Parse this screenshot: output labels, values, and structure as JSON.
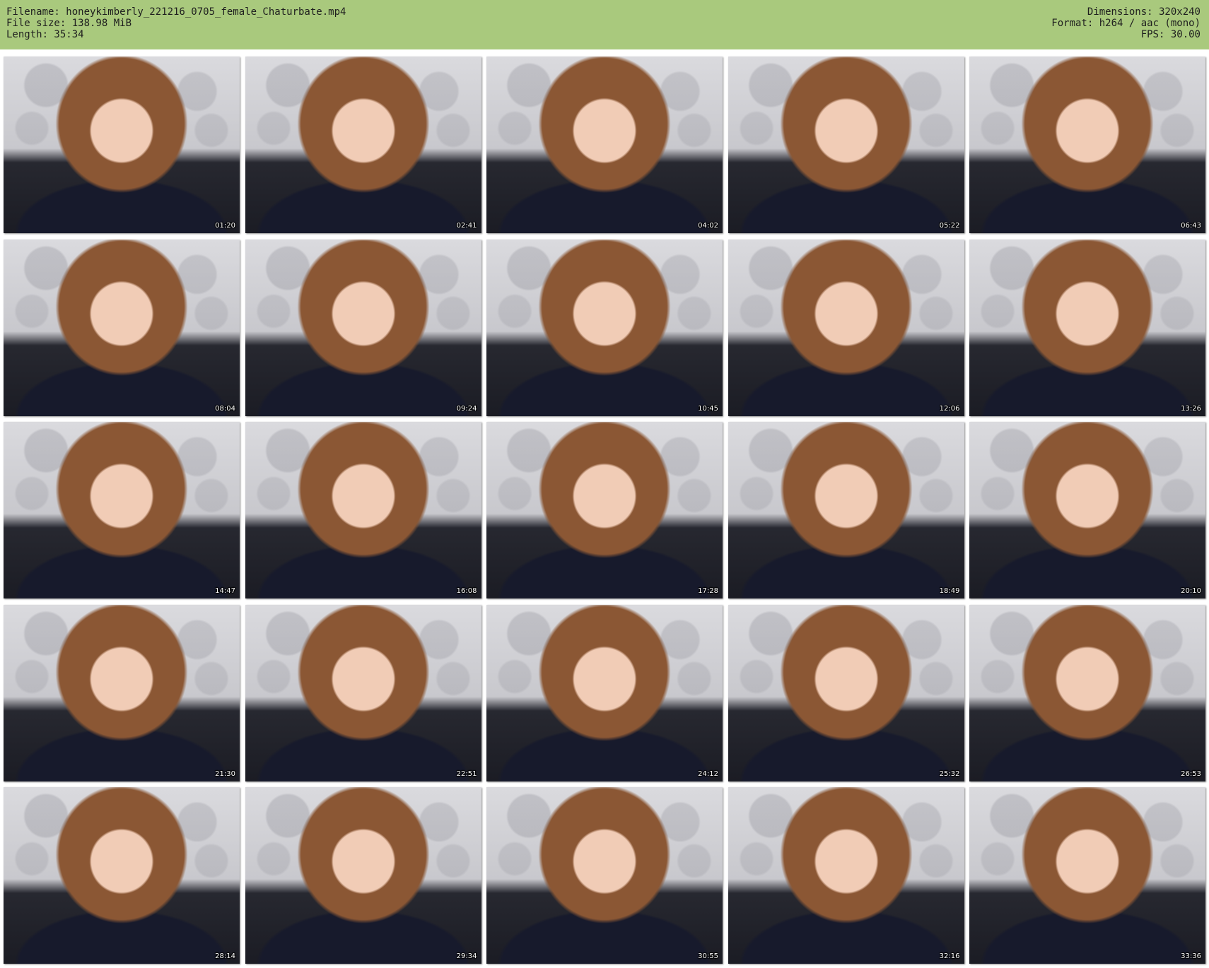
{
  "header": {
    "filename": "Filename: honeykimberly_221216_0705_female_Chaturbate.mp4",
    "file_size": "File size: 138.98 MiB",
    "length": "Length: 35:34",
    "dimensions": "Dimensions: 320x240",
    "format": "Format: h264 / aac (mono)",
    "fps": "FPS: 30.00",
    "background_color": "#a9c97d"
  },
  "thumbnails": [
    {
      "timestamp": "01:20"
    },
    {
      "timestamp": "02:41"
    },
    {
      "timestamp": "04:02"
    },
    {
      "timestamp": "05:22"
    },
    {
      "timestamp": "06:43"
    },
    {
      "timestamp": "08:04"
    },
    {
      "timestamp": "09:24"
    },
    {
      "timestamp": "10:45"
    },
    {
      "timestamp": "12:06"
    },
    {
      "timestamp": "13:26"
    },
    {
      "timestamp": "14:47"
    },
    {
      "timestamp": "16:08"
    },
    {
      "timestamp": "17:28"
    },
    {
      "timestamp": "18:49"
    },
    {
      "timestamp": "20:10"
    },
    {
      "timestamp": "21:30"
    },
    {
      "timestamp": "22:51"
    },
    {
      "timestamp": "24:12"
    },
    {
      "timestamp": "25:32"
    },
    {
      "timestamp": "26:53"
    },
    {
      "timestamp": "28:14"
    },
    {
      "timestamp": "29:34"
    },
    {
      "timestamp": "30:55"
    },
    {
      "timestamp": "32:16"
    },
    {
      "timestamp": "33:36"
    }
  ]
}
